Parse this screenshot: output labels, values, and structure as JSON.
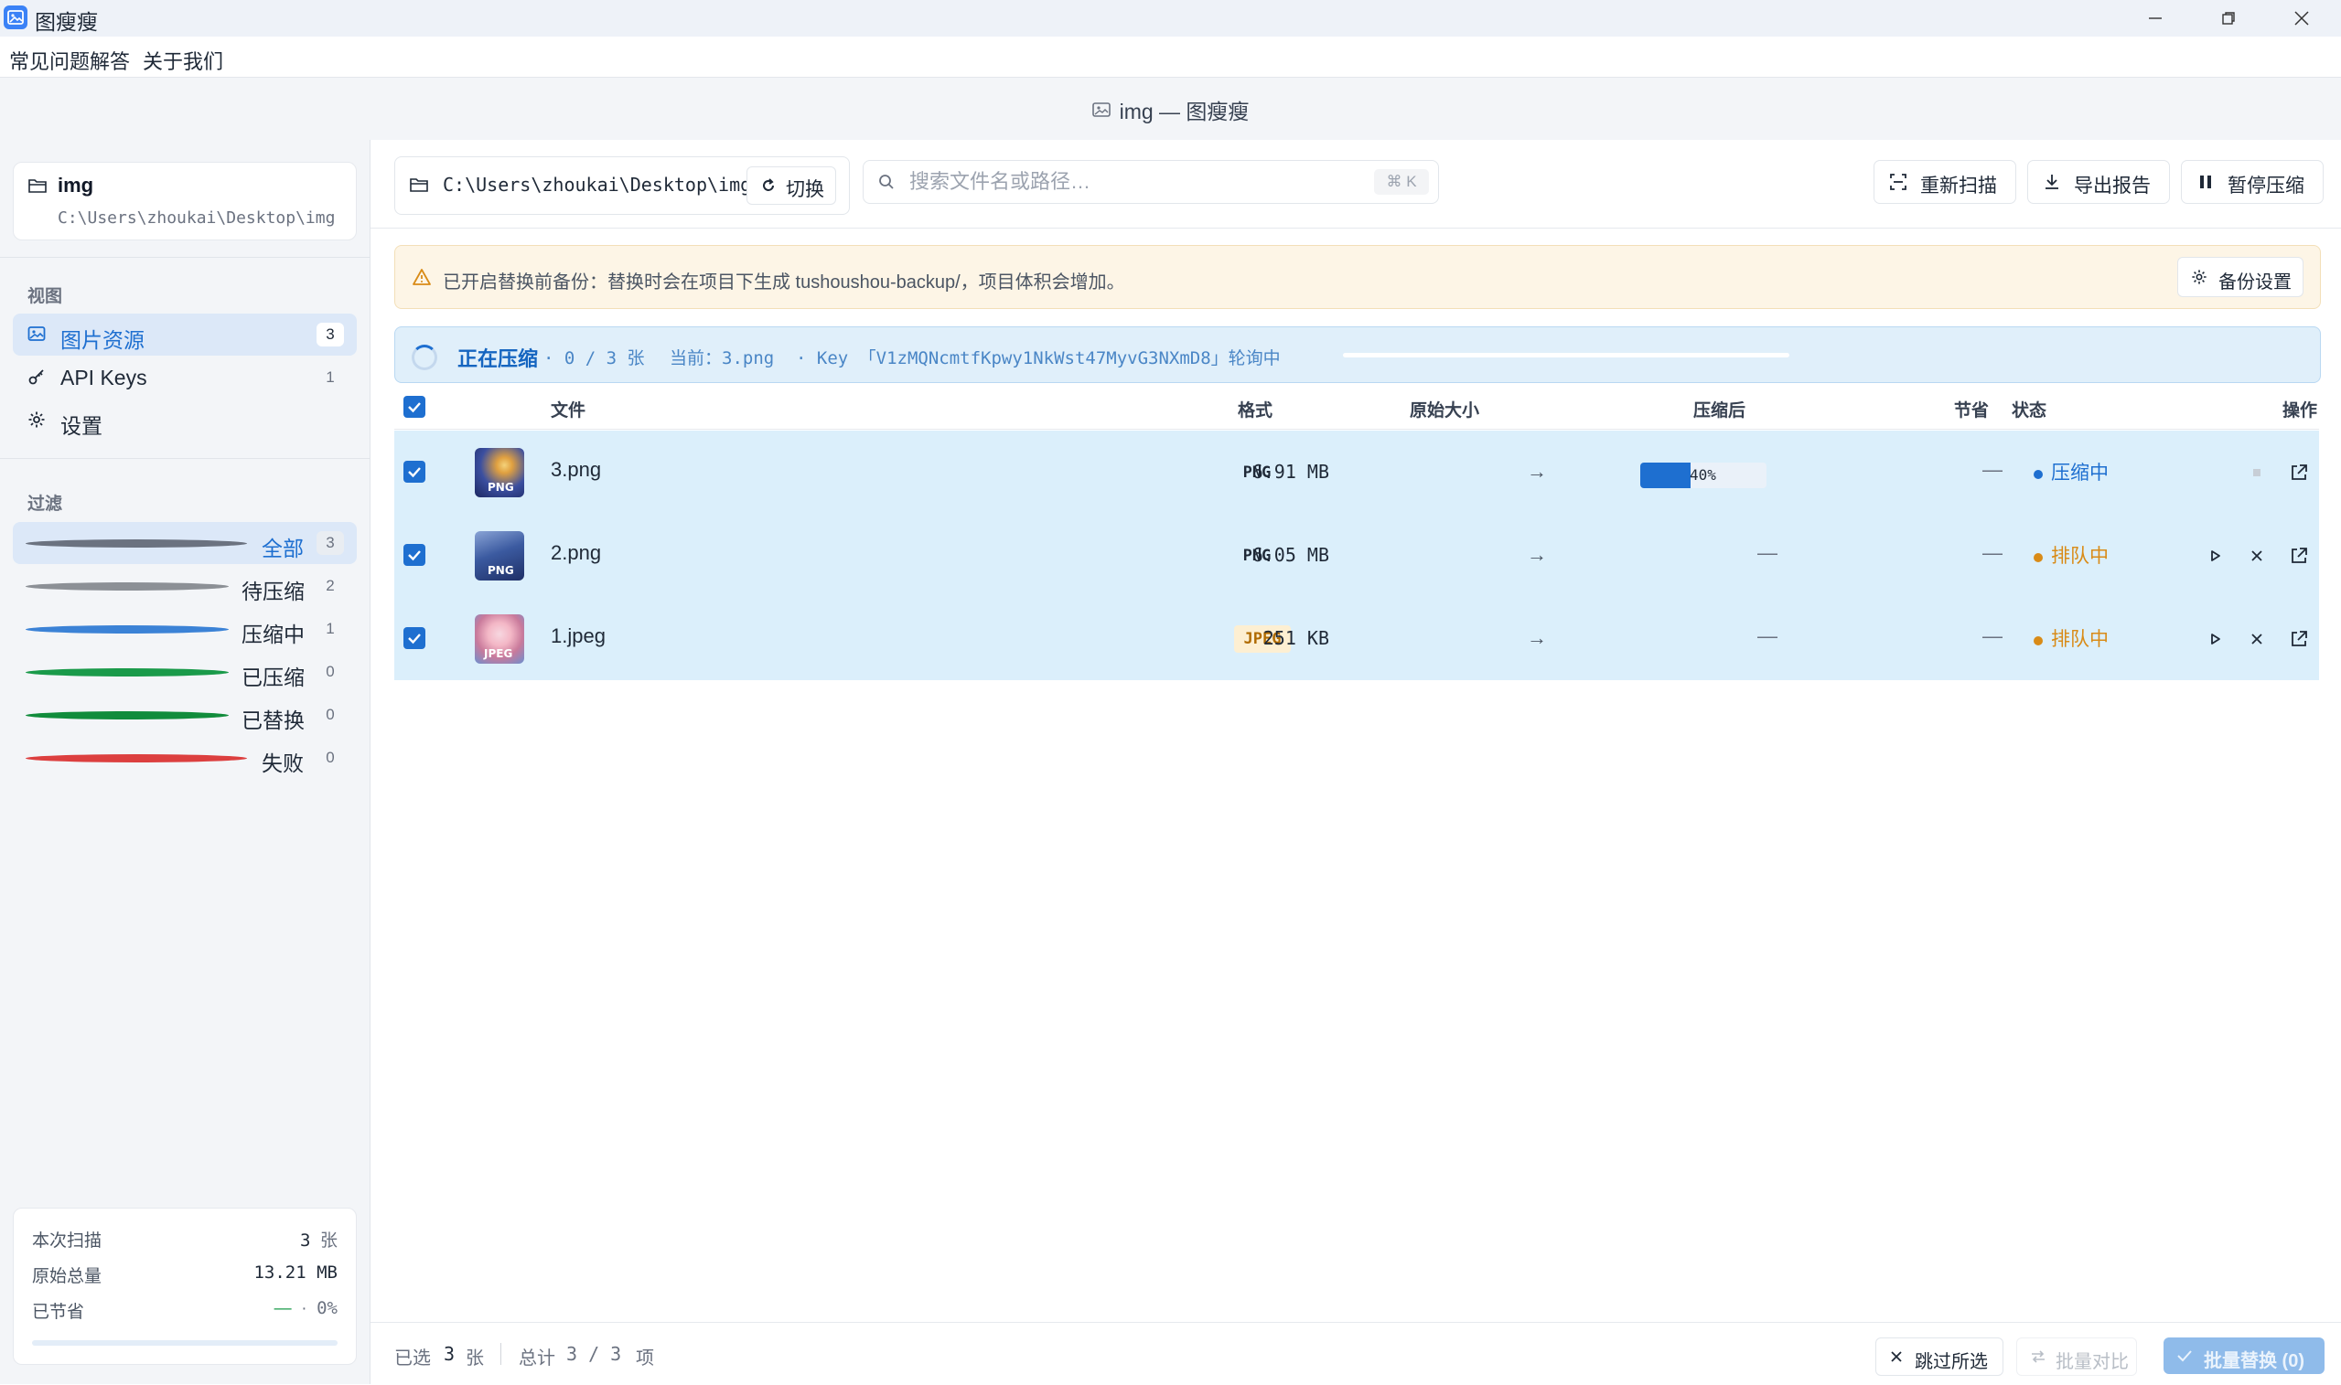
{
  "window": {
    "title": "图瘦瘦",
    "header_title": "img — 图瘦瘦"
  },
  "menu": [
    "常见问题解答",
    "关于我们"
  ],
  "sidebar": {
    "project": {
      "name": "img",
      "path": "C:\\Users\\zhoukai\\Desktop\\img"
    },
    "views_label": "视图",
    "views": [
      {
        "label": "图片资源",
        "count": "3",
        "icon": "image-icon",
        "active": true
      },
      {
        "label": "API Keys",
        "count": "1",
        "icon": "key-icon",
        "active": false
      },
      {
        "label": "设置",
        "count": "",
        "icon": "gear-icon",
        "active": false
      }
    ],
    "filter_label": "过滤",
    "filters": [
      {
        "label": "全部",
        "count": "3",
        "color": "#6b7280",
        "active": true
      },
      {
        "label": "待压缩",
        "count": "2",
        "color": "#8c9096",
        "active": false
      },
      {
        "label": "压缩中",
        "count": "1",
        "color": "#3b82d6",
        "active": false
      },
      {
        "label": "已压缩",
        "count": "0",
        "color": "#1a9a4a",
        "active": false
      },
      {
        "label": "已替换",
        "count": "0",
        "color": "#118c3c",
        "active": false
      },
      {
        "label": "失败",
        "count": "0",
        "color": "#dc3f3f",
        "active": false
      }
    ],
    "stats": {
      "scan_label": "本次扫描",
      "scan_value": "3",
      "scan_unit": "张",
      "orig_label": "原始总量",
      "orig_value": "13.21 MB",
      "saved_label": "已节省",
      "saved_value": "—",
      "saved_sep": "·",
      "saved_pct": "0%",
      "saved_fraction": 0
    }
  },
  "toolbar": {
    "path": "C:\\Users\\zhoukai\\Desktop\\img",
    "switch_label": "切换",
    "search_placeholder": "搜索文件名或路径…",
    "search_shortcut": "⌘ K",
    "rescan_label": "重新扫描",
    "export_label": "导出报告",
    "pause_label": "暂停压缩"
  },
  "backup_banner": {
    "text": "已开启替换前备份：替换时会在项目下生成 tushoushou-backup/，项目体积会增加。",
    "button_label": "备份设置"
  },
  "progress_banner": {
    "title": "正在压缩",
    "progress": "· 0 / 3 张",
    "current": "当前：3.png",
    "key_info": "· Key 「V1zMQNcmtfKpwy1NkWst47MyvG3NXmD8」轮询中",
    "fraction": 0
  },
  "table": {
    "headers": {
      "file": "文件",
      "format": "格式",
      "orig_size": "原始大小",
      "compressed": "压缩后",
      "saved": "节省",
      "status": "状态",
      "actions": "操作"
    },
    "rows": [
      {
        "name": "3.png",
        "format": "PNG",
        "orig_size": "6.91 MB",
        "arrow": "→",
        "progress_label": "40%",
        "progress": 0.4,
        "compressed": "",
        "saved": "—",
        "status": "压缩中",
        "status_color": "#1e6fd0",
        "thumb_tag": "PNG",
        "thumb_colors": [
          "#f4d27a",
          "#3b4fa0"
        ]
      },
      {
        "name": "2.png",
        "format": "PNG",
        "orig_size": "6.05 MB",
        "arrow": "→",
        "progress_label": "",
        "progress": null,
        "compressed": "—",
        "saved": "—",
        "status": "排队中",
        "status_color": "#d98b17",
        "thumb_tag": "PNG",
        "thumb_colors": [
          "#8aa4d6",
          "#1f2f66"
        ]
      },
      {
        "name": "1.jpeg",
        "format": "JPEG",
        "orig_size": "251 KB",
        "arrow": "→",
        "progress_label": "",
        "progress": null,
        "compressed": "—",
        "saved": "—",
        "status": "排队中",
        "status_color": "#d98b17",
        "thumb_tag": "JPEG",
        "thumb_colors": [
          "#f3b7c6",
          "#6c8fcf"
        ]
      }
    ]
  },
  "footer": {
    "selected_label": "已选",
    "selected_count": "3",
    "selected_unit": "张",
    "total_label": "总计",
    "total_value": "3 / 3",
    "total_unit": "项",
    "skip_label": "跳过所选",
    "compare_label": "批量对比",
    "replace_label": "批量替换 (0)"
  },
  "colors": {
    "accent": "#1e6fd0",
    "warning_bg": "#fdf5e6",
    "info_bg": "#e0effa",
    "row_bg": "#dbeffb"
  }
}
